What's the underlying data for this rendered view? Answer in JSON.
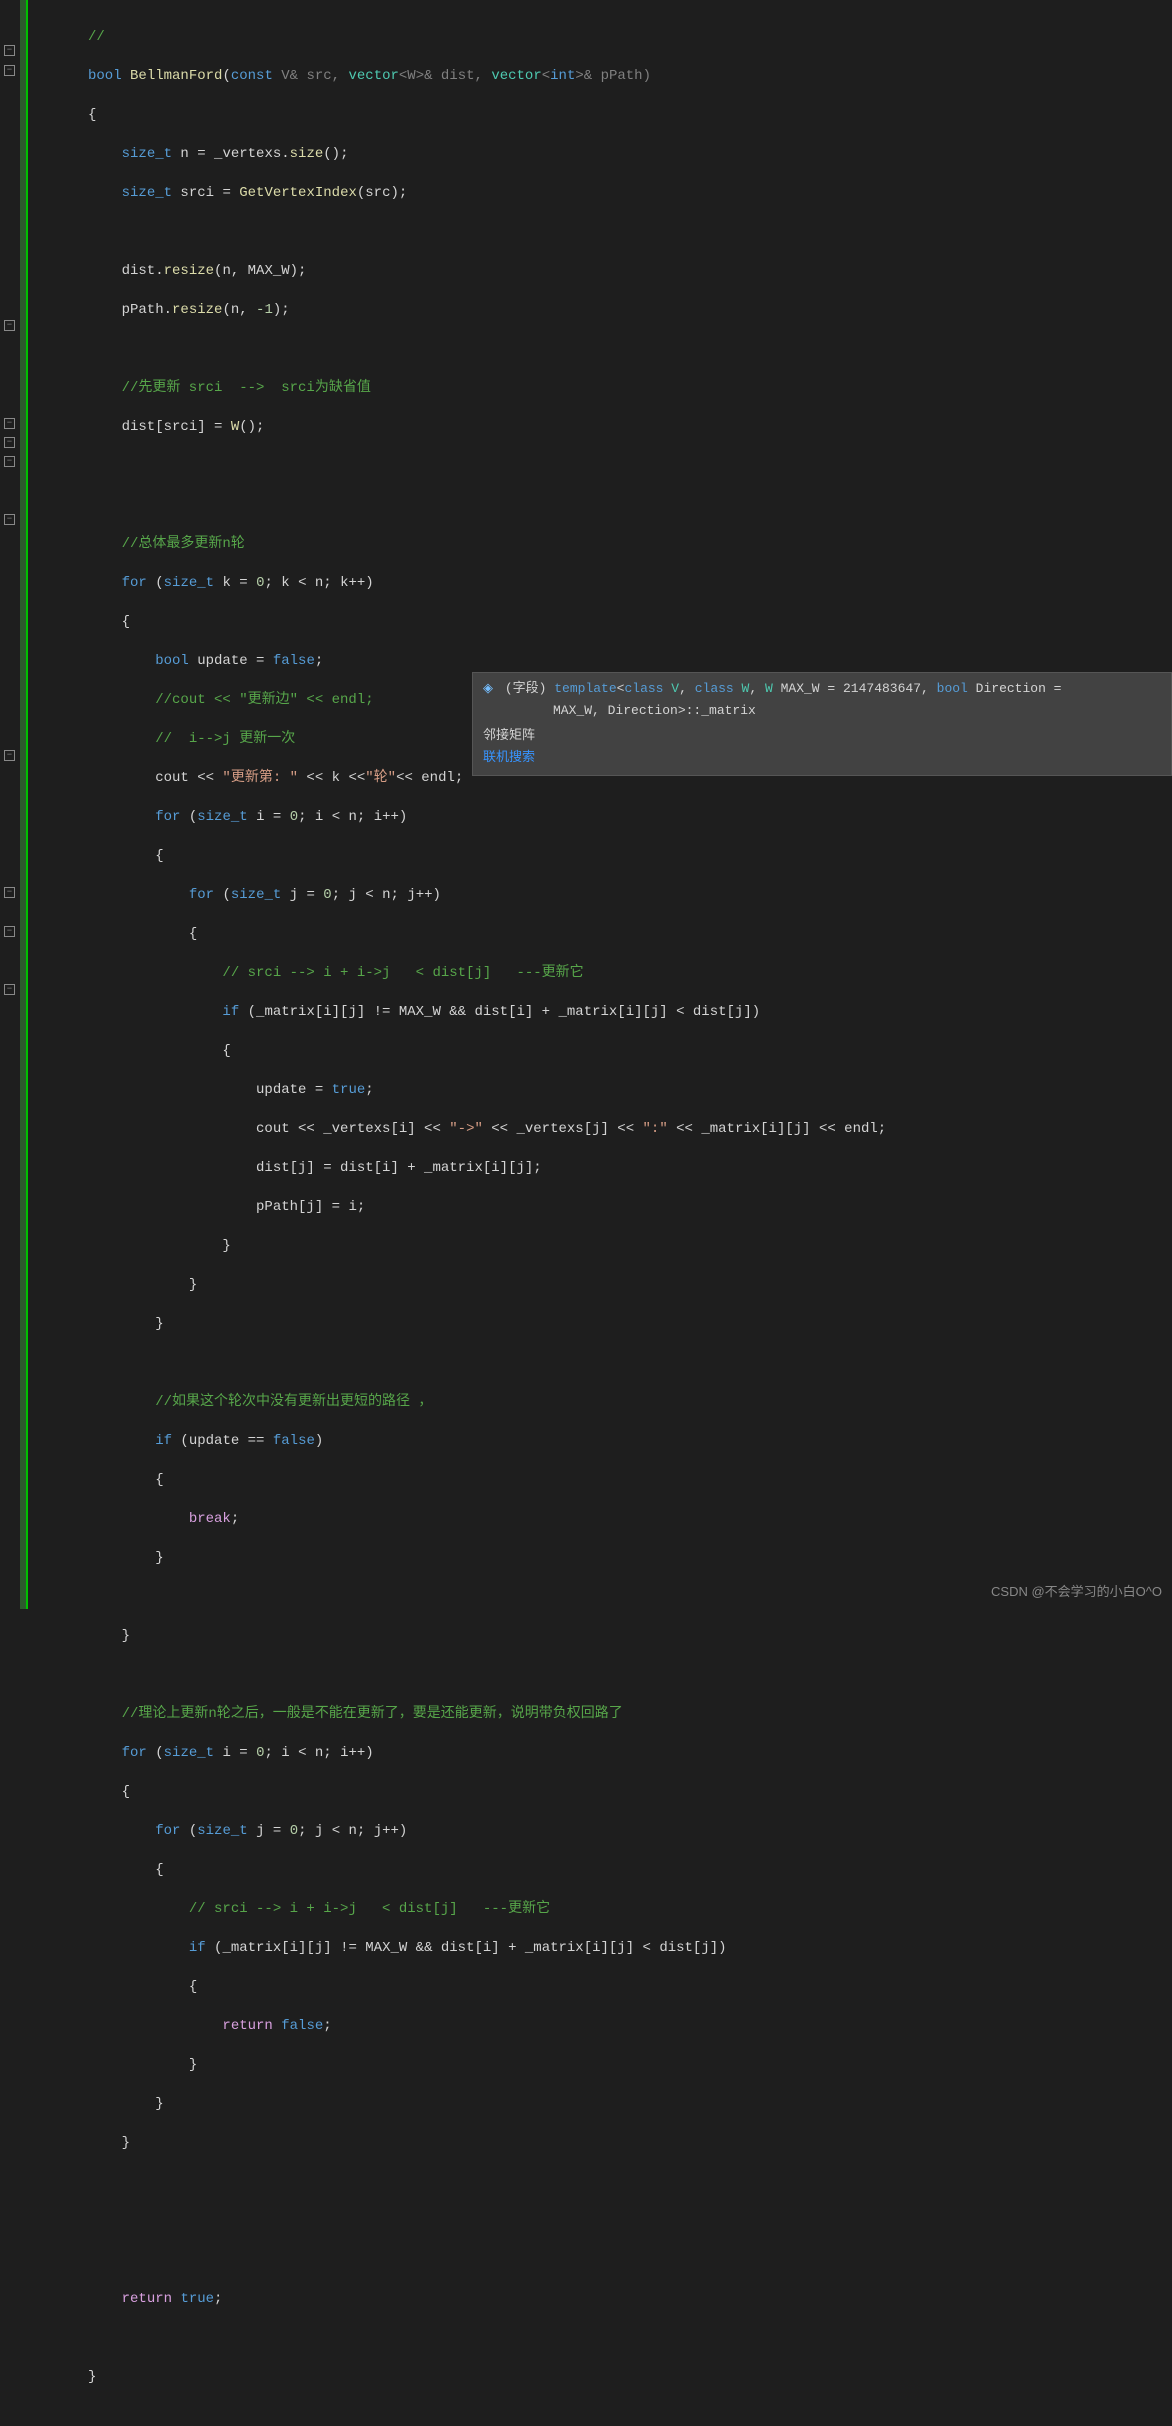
{
  "code": {
    "l1": "//",
    "l2_bool": "bool",
    "l2_func": " BellmanFord",
    "l2_a": "(",
    "l2_const": "const",
    "l2_b": " V& src, ",
    "l2_vector": "vector",
    "l2_c": "<W>& dist, ",
    "l2_vector2": "vector",
    "l2_d": "<",
    "l2_int": "int",
    "l2_e": ">& pPath)",
    "l3": "{",
    "l4_a": "    ",
    "l4_type": "size_t",
    "l4_b": " n = _vertexs.",
    "l4_func": "size",
    "l4_c": "();",
    "l5_a": "    ",
    "l5_type": "size_t",
    "l5_b": " srci = ",
    "l5_func": "GetVertexIndex",
    "l5_c": "(src);",
    "l7_a": "    dist.",
    "l7_func": "resize",
    "l7_b": "(n, MAX_W);",
    "l8_a": "    pPath.",
    "l8_func": "resize",
    "l8_b": "(n, ",
    "l8_num": "-1",
    "l8_c": ");",
    "l10": "    //先更新 srci  -->  srci为缺省值",
    "l11_a": "    dist[srci] = ",
    "l11_func": "W",
    "l11_b": "();",
    "l14": "    //总体最多更新n轮",
    "l15_a": "    ",
    "l15_for": "for",
    "l15_b": " (",
    "l15_type": "size_t",
    "l15_c": " k = ",
    "l15_num": "0",
    "l15_d": "; k < n; k++)",
    "l16": "    {",
    "l17_a": "        ",
    "l17_bool": "bool",
    "l17_b": " update = ",
    "l17_false": "false",
    "l17_c": ";",
    "l18": "        //cout << \"更新边\" << endl;",
    "l19": "        //  i-->j 更新一次",
    "l20_a": "        cout << ",
    "l20_str1": "\"更新第: \"",
    "l20_b": " << k <<",
    "l20_str2": "\"轮\"",
    "l20_c": "<< endl;",
    "l21_a": "        ",
    "l21_for": "for",
    "l21_b": " (",
    "l21_type": "size_t",
    "l21_c": " i = ",
    "l21_num": "0",
    "l21_d": "; i < n; i++)",
    "l22": "        {",
    "l23_a": "            ",
    "l23_for": "for",
    "l23_b": " (",
    "l23_type": "size_t",
    "l23_c": " j = ",
    "l23_num": "0",
    "l23_d": "; j < n; j++)",
    "l24": "            {",
    "l25": "                // srci --> i + i->j   < dist[j]   ---更新它",
    "l26_a": "                ",
    "l26_if": "if",
    "l26_b": " (_matrix[i][j] != MAX_W && dist[i] + _matrix[i][j] < dist[j])",
    "l27": "                {",
    "l28_a": "                    update = ",
    "l28_true": "true",
    "l28_b": ";",
    "l29_a": "                    cout << _vertexs[i] << ",
    "l29_str1": "\"->\"",
    "l29_b": " << _vertexs[j] << ",
    "l29_str2": "\":\"",
    "l29_c": " << _matrix[i][j] << endl;",
    "l30": "                    dist[j] = dist[i] + _matrix[i][j];",
    "l31": "                    pPath[j] = i;",
    "l32": "                }",
    "l33": "            }",
    "l34": "        }",
    "l36": "        //如果这个轮次中没有更新出更短的路径 ，",
    "l37_a": "        ",
    "l37_if": "if",
    "l37_b": " (update == ",
    "l37_false": "false",
    "l37_c": ")",
    "l38": "        {",
    "l39_a": "            ",
    "l39_break": "break",
    "l39_b": ";",
    "l40": "        }",
    "l42": "    }",
    "l44": "    //理论上更新n轮之后，一般是不能在更新了，要是还能更新，说明带负权回路了",
    "l45_a": "    ",
    "l45_for": "for",
    "l45_b": " (",
    "l45_type": "size_t",
    "l45_c": " i = ",
    "l45_num": "0",
    "l45_d": "; i < n; i++)",
    "l46": "    {",
    "l47_a": "        ",
    "l47_for": "for",
    "l47_b": " (",
    "l47_type": "size_t",
    "l47_c": " j = ",
    "l47_num": "0",
    "l47_d": "; j < n; j++)",
    "l48": "        {",
    "l49": "            // srci --> i + i->j   < dist[j]   ---更新它",
    "l50_a": "            ",
    "l50_if": "if",
    "l50_b": " (_matrix[i][j] != MAX_W && dist[i] + _matrix[i][j] < dist[j])",
    "l51": "            {",
    "l52_a": "                ",
    "l52_return": "return",
    "l52_b": " ",
    "l52_false": "false",
    "l52_c": ";",
    "l53": "            }",
    "l54": "        }",
    "l55": "    }",
    "l59_a": "    ",
    "l59_return": "return",
    "l59_b": " ",
    "l59_true": "true",
    "l59_c": ";",
    "l61": "}"
  },
  "tooltip": {
    "field_label": "(字段)",
    "template": "template",
    "class1": "class",
    "v": "V",
    "class2": "class",
    "w": "W",
    "w2": "W",
    "maxw": "MAX_W = 2147483647,",
    "bool": "bool",
    "direction": "Direction = ",
    "line2": "MAX_W, Direction>::_matrix",
    "desc": "邻接矩阵",
    "link": "联机搜索"
  },
  "watermark": "CSDN @不会学习的小白O^O",
  "fold_positions": [
    45,
    65,
    320,
    418,
    437,
    456,
    514,
    750,
    887,
    926,
    984
  ]
}
